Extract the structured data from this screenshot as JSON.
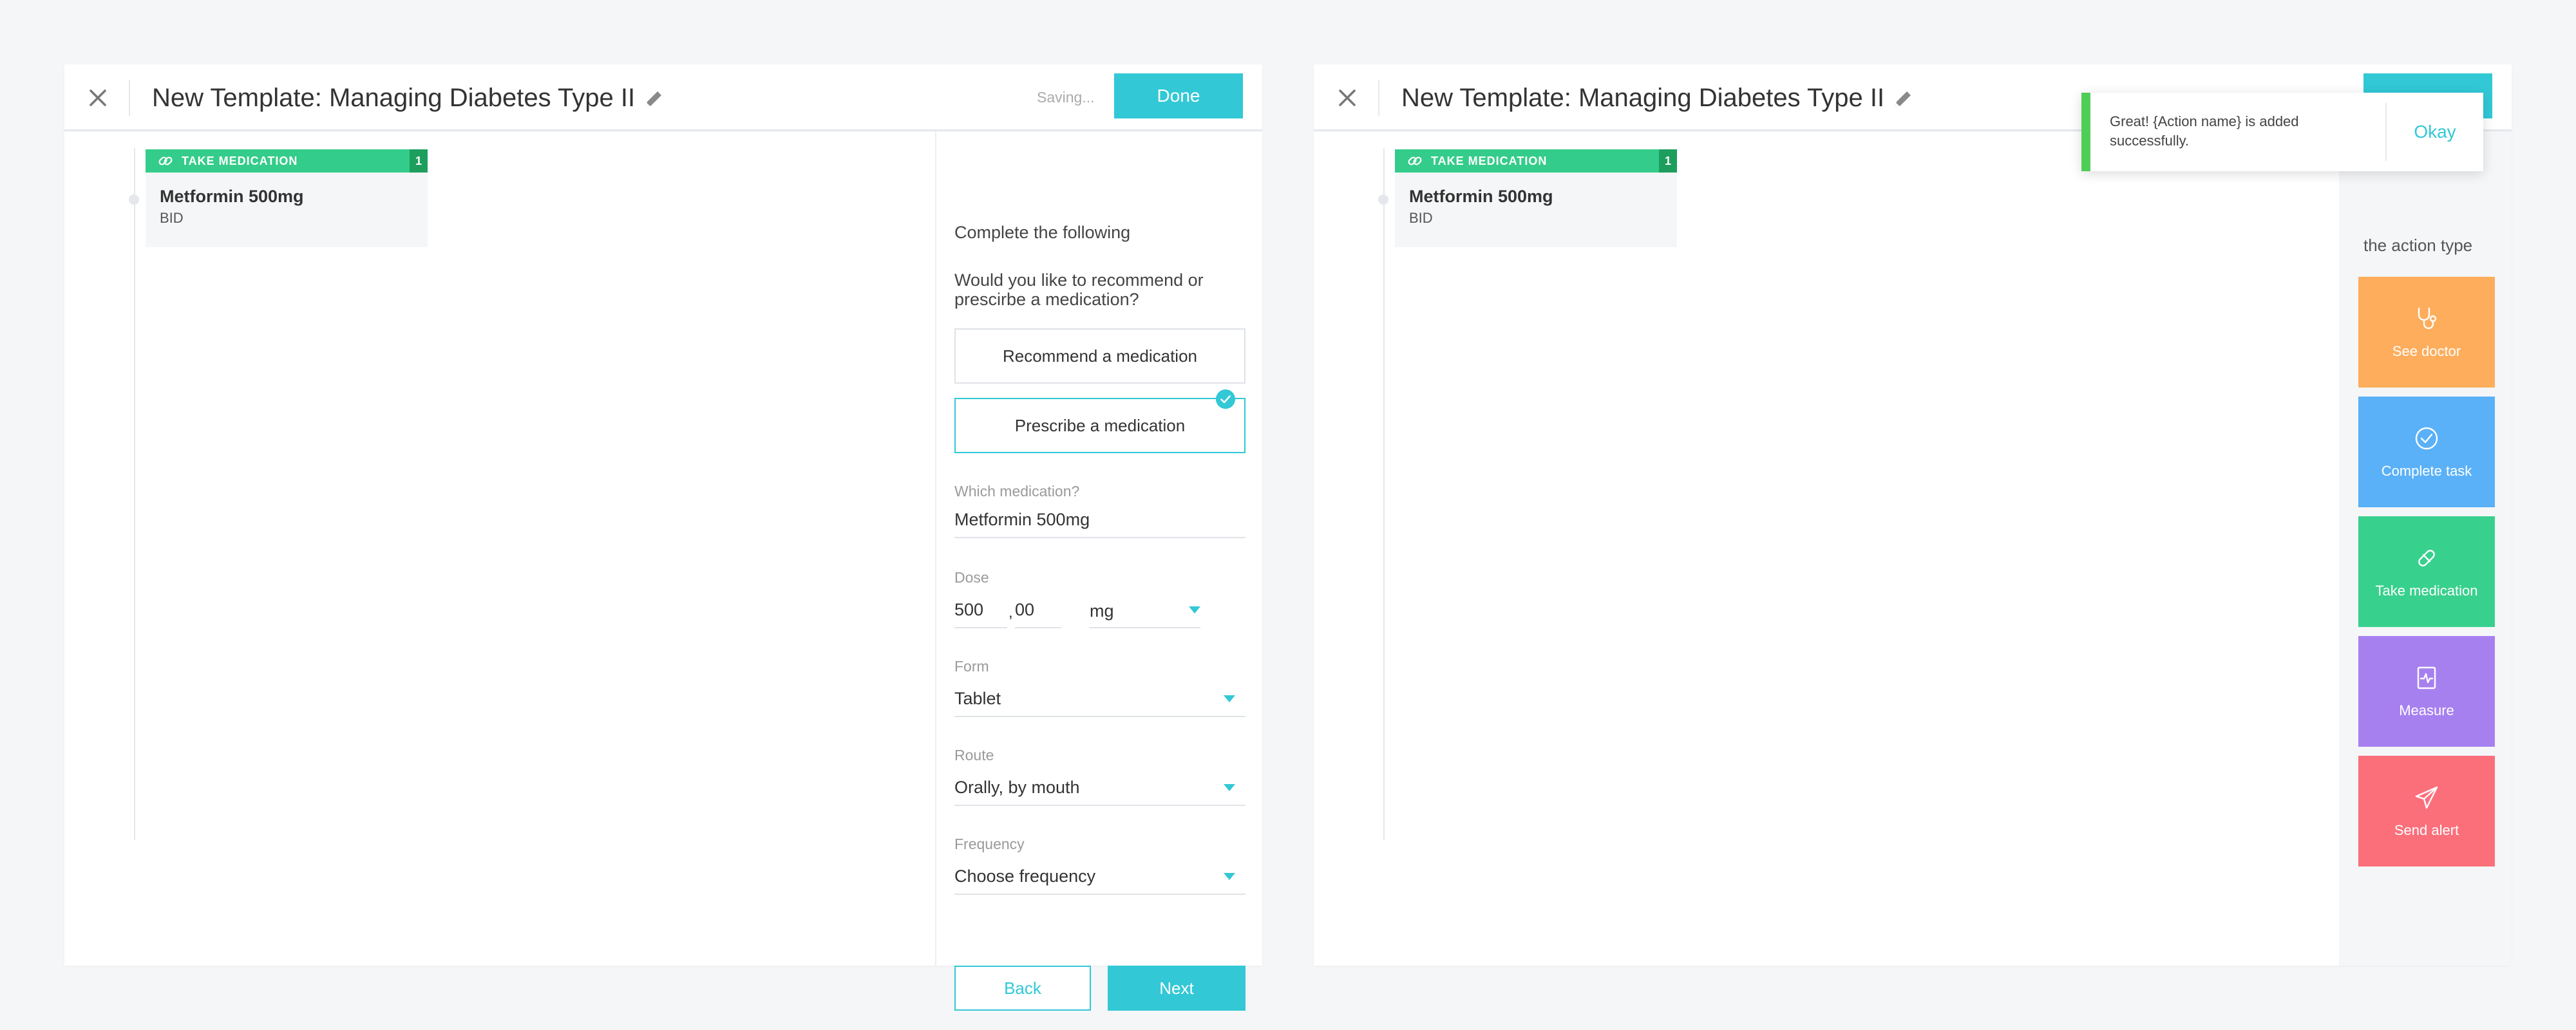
{
  "editor": {
    "title": "New Template: Managing Diabetes Type II",
    "saving_text": "Saving...",
    "done_label": "Done",
    "card": {
      "tag": "TAKE MEDICATION",
      "count": "1",
      "name": "Metformin 500mg",
      "frequency": "BID"
    },
    "form": {
      "heading": "Complete the following",
      "question": "Would you like to recommend or prescirbe a medication?",
      "options": [
        "Recommend a medication",
        "Prescribe a medication"
      ],
      "selected_option": "Prescribe a medication",
      "medication_label": "Which medication?",
      "medication_value": "Metformin 500mg",
      "dose_label": "Dose",
      "dose_whole": "500",
      "dose_sep": ",",
      "dose_fraction": "00",
      "dose_unit": "mg",
      "form_label": "Form",
      "form_value": "Tablet",
      "route_label": "Route",
      "route_value": "Orally, by mouth",
      "frequency_label": "Frequency",
      "frequency_value": "Choose frequency",
      "back_label": "Back",
      "next_label": "Next"
    }
  },
  "preview": {
    "title": "New Template: Managing Diabetes Type II",
    "card": {
      "tag": "TAKE MEDICATION",
      "count": "1",
      "name": "Metformin 500mg",
      "frequency": "BID"
    },
    "sidebar_text": "the action type",
    "tiles": [
      {
        "label": "See doctor",
        "icon": "stethoscope-icon",
        "color": "#fdad5c"
      },
      {
        "label": "Complete task",
        "icon": "check-circle-icon",
        "color": "#5ab1f7"
      },
      {
        "label": "Take medication",
        "icon": "pill-icon",
        "color": "#38d08d"
      },
      {
        "label": "Measure",
        "icon": "pulse-document-icon",
        "color": "#a780f0"
      },
      {
        "label": "Send alert",
        "icon": "paper-plane-icon",
        "color": "#fb6f7b"
      }
    ],
    "toast": {
      "message": "Great! {Action name} is added successfully.",
      "ok_label": "Okay",
      "accent": "#4fce57"
    }
  },
  "colors": {
    "accent": "#32c8d6",
    "card_green": "#34cc8a",
    "count_green": "#1d9e5d"
  }
}
